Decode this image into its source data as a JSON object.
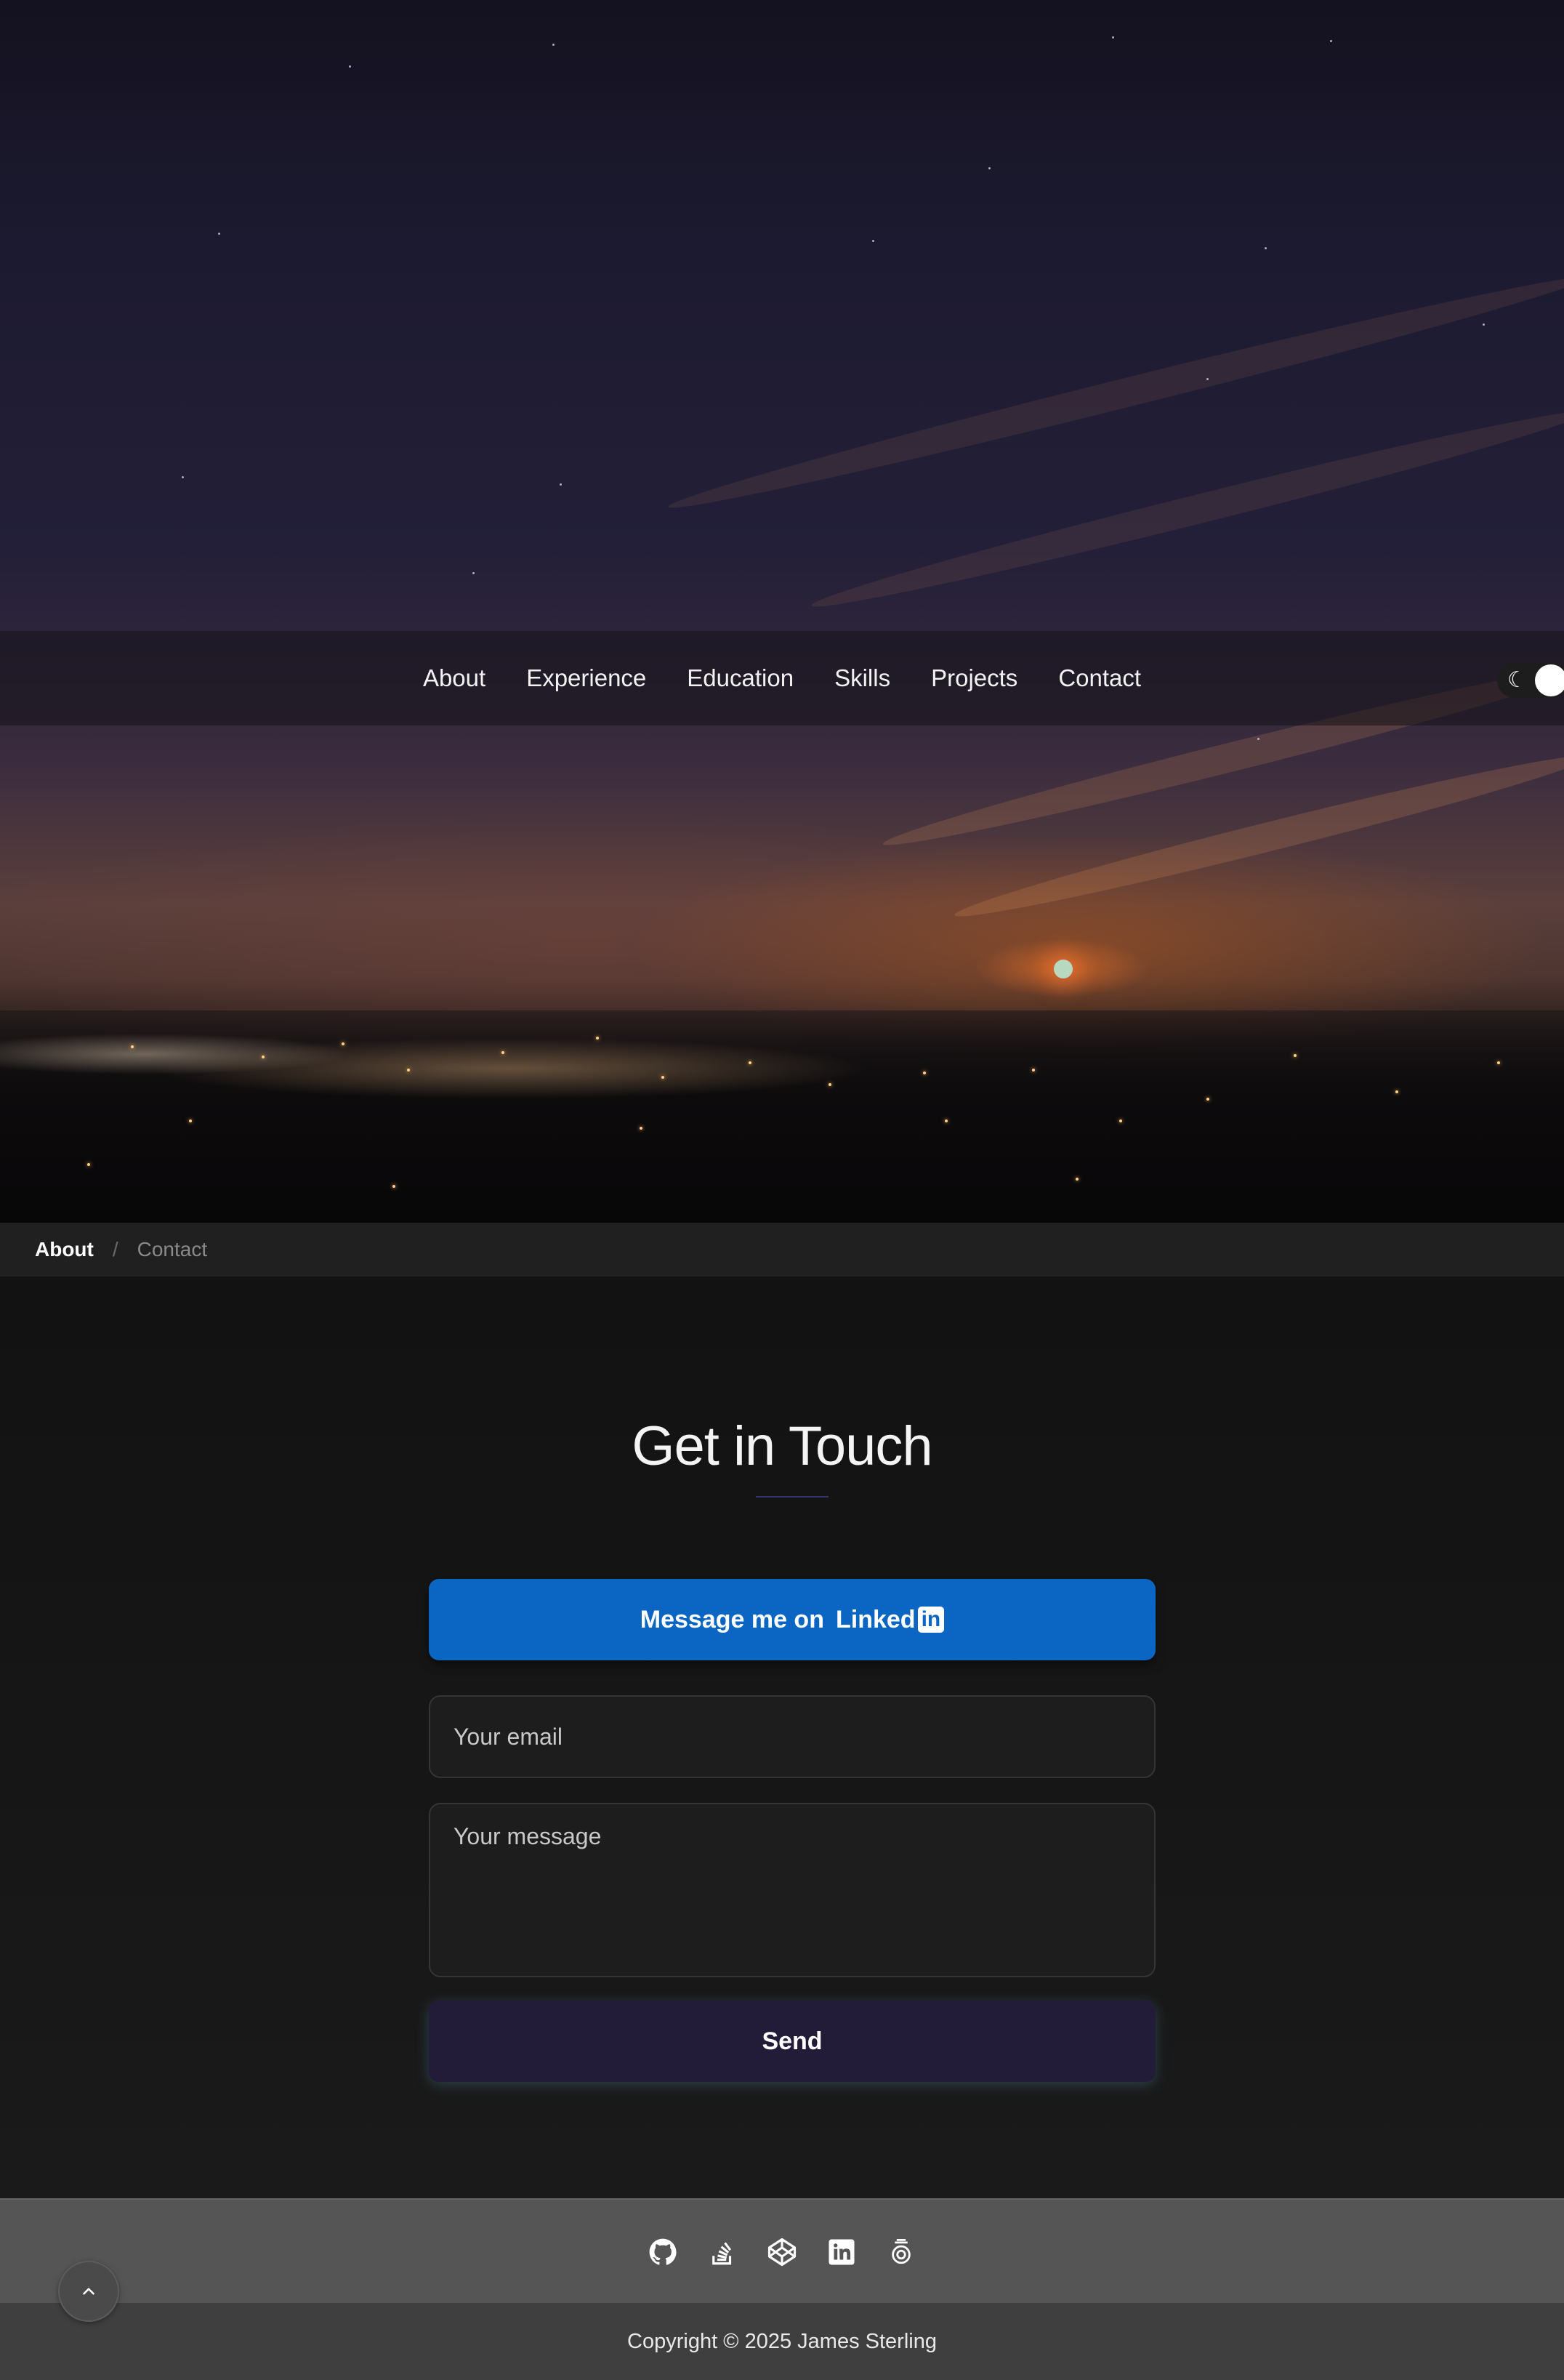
{
  "nav": {
    "links": [
      "About",
      "Experience",
      "Education",
      "Skills",
      "Projects",
      "Contact"
    ],
    "theme_toggle_icon": "moon-icon"
  },
  "breadcrumb": {
    "home": "About",
    "separator": "/",
    "current": "Contact"
  },
  "contact": {
    "title": "Get in Touch",
    "linkedin_button": {
      "label": "Message me on",
      "logo_text": "Linked",
      "logo_box": "in"
    },
    "email_placeholder": "Your email",
    "message_placeholder": "Your message",
    "send_label": "Send"
  },
  "footer": {
    "social_icons": [
      "github-icon",
      "stackoverflow-icon",
      "codepen-icon",
      "linkedin-icon",
      "freecodecamp-icon"
    ],
    "copyright": "Copyright © 2025 James Sterling",
    "back_to_top_icon": "chevron-up-icon"
  },
  "colors": {
    "linkedin_blue": "#0a66c2",
    "send_button": "#231c38",
    "footer_top": "#555555",
    "footer_bottom": "#3f3f3f"
  }
}
